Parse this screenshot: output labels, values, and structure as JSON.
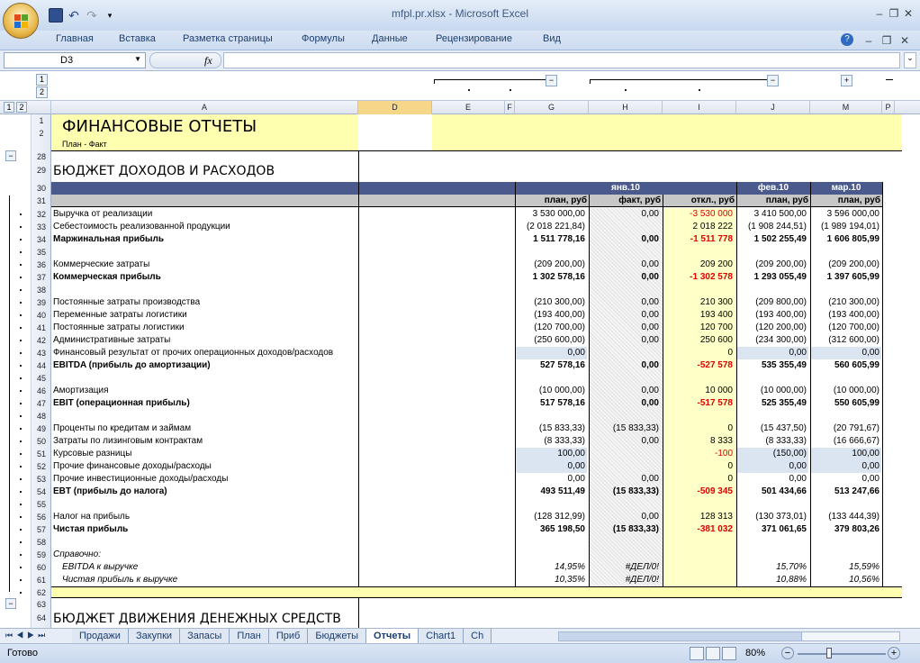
{
  "title": "mfpl.pr.xlsx - Microsoft Excel",
  "ribbon_tabs": [
    "Главная",
    "Вставка",
    "Разметка страницы",
    "Формулы",
    "Данные",
    "Рецензирование",
    "Вид"
  ],
  "namebox": "D3",
  "fx": "fx",
  "outline_levels": [
    "1",
    "2"
  ],
  "col_headers": [
    "A",
    "D",
    "E",
    "F",
    "G",
    "H",
    "I",
    "J",
    "M",
    "P"
  ],
  "header": {
    "title": "ФИНАНСОВЫЕ ОТЧЕТЫ",
    "subtitle": "План - Факт"
  },
  "section1_title": "БЮДЖЕТ ДОХОДОВ И РАСХОДОВ",
  "section2_title": "БЮДЖЕТ ДВИЖЕНИЯ ДЕНЕЖНЫХ СРЕДСТВ",
  "months": [
    "янв.10",
    "фев.10",
    "мар.10"
  ],
  "subheaders": [
    "план, руб",
    "факт, руб",
    "откл., руб",
    "план, руб",
    "план, руб"
  ],
  "rows": [
    {
      "n": "32",
      "label": "Выручка от реализации",
      "bold": false,
      "g": "3 530 000,00",
      "h": "0,00",
      "i": "-3 530 000",
      "j": "3 410 500,00",
      "m": "3 596 000,00"
    },
    {
      "n": "33",
      "label": "Себестоимость реализованной продукции",
      "bold": false,
      "g": "(2 018 221,84)",
      "h": "",
      "i": "2 018 222",
      "j": "(1 908 244,51)",
      "m": "(1 989 194,01)"
    },
    {
      "n": "34",
      "label": "Маржинальная прибыль",
      "bold": true,
      "g": "1 511 778,16",
      "h": "0,00",
      "i": "-1 511 778",
      "j": "1 502 255,49",
      "m": "1 606 805,99"
    },
    {
      "n": "35",
      "label": "",
      "bold": false,
      "g": "",
      "h": "",
      "i": "",
      "j": "",
      "m": ""
    },
    {
      "n": "36",
      "label": "Коммерческие затраты",
      "bold": false,
      "g": "(209 200,00)",
      "h": "0,00",
      "i": "209 200",
      "j": "(209 200,00)",
      "m": "(209 200,00)"
    },
    {
      "n": "37",
      "label": "Коммерческая прибыль",
      "bold": true,
      "g": "1 302 578,16",
      "h": "0,00",
      "i": "-1 302 578",
      "j": "1 293 055,49",
      "m": "1 397 605,99"
    },
    {
      "n": "38",
      "label": "",
      "bold": false,
      "g": "",
      "h": "",
      "i": "",
      "j": "",
      "m": ""
    },
    {
      "n": "39",
      "label": "Постоянные затраты производства",
      "bold": false,
      "g": "(210 300,00)",
      "h": "0,00",
      "i": "210 300",
      "j": "(209 800,00)",
      "m": "(210 300,00)"
    },
    {
      "n": "40",
      "label": "Переменные затраты логистики",
      "bold": false,
      "g": "(193 400,00)",
      "h": "0,00",
      "i": "193 400",
      "j": "(193 400,00)",
      "m": "(193 400,00)"
    },
    {
      "n": "41",
      "label": "Постоянные затраты логистики",
      "bold": false,
      "g": "(120 700,00)",
      "h": "0,00",
      "i": "120 700",
      "j": "(120 200,00)",
      "m": "(120 700,00)"
    },
    {
      "n": "42",
      "label": "Административные затраты",
      "bold": false,
      "g": "(250 600,00)",
      "h": "0,00",
      "i": "250 600",
      "j": "(234 300,00)",
      "m": "(312 600,00)"
    },
    {
      "n": "43",
      "label": "Финансовый результат от прочих операционных доходов/расходов",
      "bold": false,
      "g": "0,00",
      "h": "",
      "i": "0",
      "j": "0,00",
      "m": "0,00"
    },
    {
      "n": "44",
      "label": "EBITDA (прибыль до амортизации)",
      "bold": true,
      "g": "527 578,16",
      "h": "0,00",
      "i": "-527 578",
      "j": "535 355,49",
      "m": "560 605,99"
    },
    {
      "n": "45",
      "label": "",
      "bold": false,
      "g": "",
      "h": "",
      "i": "",
      "j": "",
      "m": ""
    },
    {
      "n": "46",
      "label": "Амортизация",
      "bold": false,
      "g": "(10 000,00)",
      "h": "0,00",
      "i": "10 000",
      "j": "(10 000,00)",
      "m": "(10 000,00)"
    },
    {
      "n": "47",
      "label": "EBIT (операционная прибыль)",
      "bold": true,
      "g": "517 578,16",
      "h": "0,00",
      "i": "-517 578",
      "j": "525 355,49",
      "m": "550 605,99"
    },
    {
      "n": "48",
      "label": "",
      "bold": false,
      "g": "",
      "h": "",
      "i": "",
      "j": "",
      "m": ""
    },
    {
      "n": "49",
      "label": "Проценты по кредитам и займам",
      "bold": false,
      "g": "(15 833,33)",
      "h": "(15 833,33)",
      "i": "0",
      "j": "(15 437,50)",
      "m": "(20 791,67)"
    },
    {
      "n": "50",
      "label": "Затраты по лизинговым контрактам",
      "bold": false,
      "g": "(8 333,33)",
      "h": "0,00",
      "i": "8 333",
      "j": "(8 333,33)",
      "m": "(16 666,67)"
    },
    {
      "n": "51",
      "label": "Курсовые разницы",
      "bold": false,
      "g": "100,00",
      "h": "",
      "i": "-100",
      "j": "(150,00)",
      "m": "100,00"
    },
    {
      "n": "52",
      "label": "Прочие финансовые доходы/расходы",
      "bold": false,
      "g": "0,00",
      "h": "",
      "i": "0",
      "j": "0,00",
      "m": "0,00"
    },
    {
      "n": "53",
      "label": "Прочие инвестиционные доходы/расходы",
      "bold": false,
      "g": "0,00",
      "h": "0,00",
      "i": "0",
      "j": "0,00",
      "m": "0,00"
    },
    {
      "n": "54",
      "label": "EBT (прибыль до налога)",
      "bold": true,
      "g": "493 511,49",
      "h": "(15 833,33)",
      "i": "-509 345",
      "j": "501 434,66",
      "m": "513 247,66"
    },
    {
      "n": "55",
      "label": "",
      "bold": false,
      "g": "",
      "h": "",
      "i": "",
      "j": "",
      "m": ""
    },
    {
      "n": "56",
      "label": "Налог на прибыль",
      "bold": false,
      "g": "(128 312,99)",
      "h": "0,00",
      "i": "128 313",
      "j": "(130 373,01)",
      "m": "(133 444,39)"
    },
    {
      "n": "57",
      "label": "Чистая прибыль",
      "bold": true,
      "g": "365 198,50",
      "h": "(15 833,33)",
      "i": "-381 032",
      "j": "371 061,65",
      "m": "379 803,26"
    },
    {
      "n": "58",
      "label": "",
      "bold": false,
      "g": "",
      "h": "",
      "i": "",
      "j": "",
      "m": ""
    },
    {
      "n": "59",
      "label": "Справочно:",
      "bold": false,
      "italic": true,
      "g": "",
      "h": "",
      "i": "",
      "j": "",
      "m": ""
    },
    {
      "n": "60",
      "label": "EBITDA к выручке",
      "bold": false,
      "italic": true,
      "indent": true,
      "g": "14,95%",
      "h": "#ДЕЛ/0!",
      "i": "",
      "j": "15,70%",
      "m": "15,59%"
    },
    {
      "n": "61",
      "label": "Чистая прибыль к выручке",
      "bold": false,
      "italic": true,
      "indent": true,
      "g": "10,35%",
      "h": "#ДЕЛ/0!",
      "i": "",
      "j": "10,88%",
      "m": "10,56%"
    },
    {
      "n": "62",
      "label": "",
      "bold": false,
      "g": "",
      "h": "",
      "i": "",
      "j": "",
      "m": ""
    }
  ],
  "sheet_tabs": [
    "Продажи",
    "Закупки",
    "Запасы",
    "План",
    "Приб",
    "Бюджеты",
    "Отчеты",
    "Chart1",
    "Ch"
  ],
  "active_sheet": "Отчеты",
  "status_text": "Готово",
  "zoom": "80%",
  "colors": {
    "accent": "#4a5a8c",
    "yellow": "#ffffb0",
    "blue_fill": "#dbe5f1",
    "peach_fill": "#fbe2d4",
    "neg_red": "#e00000"
  }
}
